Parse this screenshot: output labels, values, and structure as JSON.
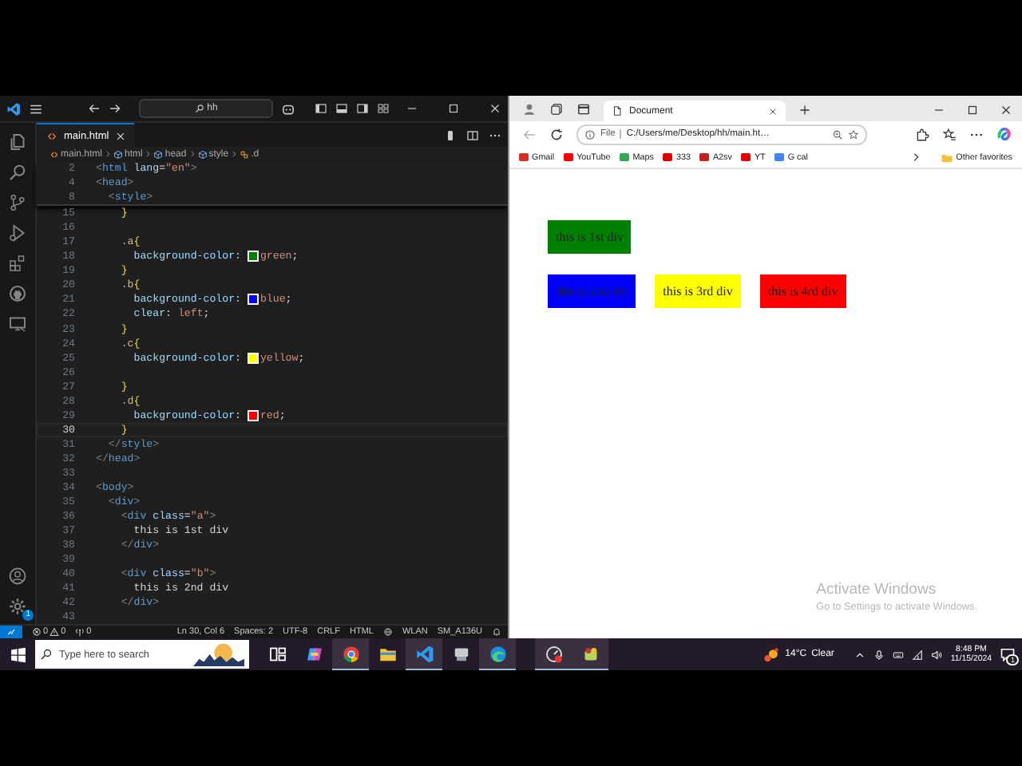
{
  "editor": {
    "search": "hh",
    "tab": {
      "label": "main.html"
    },
    "breadcrumbs": [
      {
        "label": "main.html",
        "kind": "file"
      },
      {
        "label": "html",
        "kind": "element"
      },
      {
        "label": "head",
        "kind": "element"
      },
      {
        "label": "style",
        "kind": "element"
      },
      {
        "label": ".d",
        "kind": "selector"
      }
    ],
    "settings_badge": "1",
    "sticky_lines": [
      {
        "number": "2",
        "current": false,
        "tokens": [
          {
            "text": "<",
            "kind": "punct"
          },
          {
            "text": "html",
            "kind": "tag"
          },
          {
            "text": " lang",
            "kind": "attr"
          },
          {
            "text": "=",
            "kind": "text"
          },
          {
            "text": "\"en\"",
            "kind": "string"
          },
          {
            "text": ">",
            "kind": "punct"
          }
        ]
      },
      {
        "number": "4",
        "current": false,
        "tokens": [
          {
            "text": "<",
            "kind": "punct"
          },
          {
            "text": "head",
            "kind": "tag"
          },
          {
            "text": ">",
            "kind": "punct"
          }
        ]
      },
      {
        "number": "8",
        "current": false,
        "tokens": [
          {
            "text": "  <",
            "kind": "punct"
          },
          {
            "text": "style",
            "kind": "tag"
          },
          {
            "text": ">",
            "kind": "punct"
          }
        ]
      }
    ],
    "lines": [
      {
        "number": "15",
        "current": false,
        "tokens": [
          {
            "text": "    }",
            "kind": "brace"
          }
        ]
      },
      {
        "number": "16",
        "current": false
      },
      {
        "number": "17",
        "current": false,
        "tokens": [
          {
            "text": "    .a",
            "kind": "selector"
          },
          {
            "text": "{",
            "kind": "brace"
          }
        ]
      },
      {
        "number": "18",
        "current": false,
        "tokens": [
          {
            "text": "      background-color: ",
            "kind": "prop"
          },
          {
            "kind": "swatch",
            "color": "#008000"
          },
          {
            "text": "green",
            "kind": "value"
          },
          {
            "text": ";",
            "kind": "text"
          }
        ]
      },
      {
        "number": "19",
        "current": false,
        "tokens": [
          {
            "text": "    }",
            "kind": "brace"
          }
        ]
      },
      {
        "number": "20",
        "current": false,
        "tokens": [
          {
            "text": "    .b",
            "kind": "selector"
          },
          {
            "text": "{",
            "kind": "brace"
          }
        ]
      },
      {
        "number": "21",
        "current": false,
        "tokens": [
          {
            "text": "      background-color: ",
            "kind": "prop"
          },
          {
            "kind": "swatch",
            "color": "#0000ff"
          },
          {
            "text": "blue",
            "kind": "value"
          },
          {
            "text": ";",
            "kind": "text"
          }
        ]
      },
      {
        "number": "22",
        "current": false,
        "tokens": [
          {
            "text": "      clear: ",
            "kind": "prop"
          },
          {
            "text": "left",
            "kind": "value"
          },
          {
            "text": ";",
            "kind": "text"
          }
        ]
      },
      {
        "number": "23",
        "current": false,
        "tokens": [
          {
            "text": "    }",
            "kind": "brace"
          }
        ]
      },
      {
        "number": "24",
        "current": false,
        "tokens": [
          {
            "text": "    .c",
            "kind": "selector"
          },
          {
            "text": "{",
            "kind": "brace"
          }
        ]
      },
      {
        "number": "25",
        "current": false,
        "tokens": [
          {
            "text": "      background-color: ",
            "kind": "prop"
          },
          {
            "kind": "swatch",
            "color": "#ffff00"
          },
          {
            "text": "yellow",
            "kind": "value"
          },
          {
            "text": ";",
            "kind": "text"
          }
        ]
      },
      {
        "number": "26",
        "current": false
      },
      {
        "number": "27",
        "current": false,
        "tokens": [
          {
            "text": "    }",
            "kind": "brace"
          }
        ]
      },
      {
        "number": "28",
        "current": false,
        "tokens": [
          {
            "text": "    .d",
            "kind": "selector"
          },
          {
            "text": "{",
            "kind": "brace"
          }
        ]
      },
      {
        "number": "29",
        "current": false,
        "tokens": [
          {
            "text": "      background-color: ",
            "kind": "prop"
          },
          {
            "kind": "swatch",
            "color": "#ff0000"
          },
          {
            "text": "red",
            "kind": "value"
          },
          {
            "text": ";",
            "kind": "text"
          }
        ]
      },
      {
        "number": "30",
        "current": true,
        "tokens": [
          {
            "text": "    }",
            "kind": "brace"
          }
        ]
      },
      {
        "number": "31",
        "current": false,
        "tokens": [
          {
            "text": "  </",
            "kind": "punct"
          },
          {
            "text": "style",
            "kind": "tag"
          },
          {
            "text": ">",
            "kind": "punct"
          }
        ]
      },
      {
        "number": "32",
        "current": false,
        "tokens": [
          {
            "text": "</",
            "kind": "punct"
          },
          {
            "text": "head",
            "kind": "tag"
          },
          {
            "text": ">",
            "kind": "punct"
          }
        ]
      },
      {
        "number": "33",
        "current": false
      },
      {
        "number": "34",
        "current": false,
        "tokens": [
          {
            "text": "<",
            "kind": "punct"
          },
          {
            "text": "body",
            "kind": "tag"
          },
          {
            "text": ">",
            "kind": "punct"
          }
        ]
      },
      {
        "number": "35",
        "current": false,
        "tokens": [
          {
            "text": "  <",
            "kind": "punct"
          },
          {
            "text": "div",
            "kind": "tag"
          },
          {
            "text": ">",
            "kind": "punct"
          }
        ]
      },
      {
        "number": "36",
        "current": false,
        "tokens": [
          {
            "text": "    <",
            "kind": "punct"
          },
          {
            "text": "div",
            "kind": "tag"
          },
          {
            "text": " class",
            "kind": "attr"
          },
          {
            "text": "=",
            "kind": "text"
          },
          {
            "text": "\"a\"",
            "kind": "string"
          },
          {
            "text": ">",
            "kind": "punct"
          }
        ]
      },
      {
        "number": "37",
        "current": false,
        "tokens": [
          {
            "text": "      this is 1st div",
            "kind": "text"
          }
        ]
      },
      {
        "number": "38",
        "current": false,
        "tokens": [
          {
            "text": "    </",
            "kind": "punct"
          },
          {
            "text": "div",
            "kind": "tag"
          },
          {
            "text": ">",
            "kind": "punct"
          }
        ]
      },
      {
        "number": "39",
        "current": false
      },
      {
        "number": "40",
        "current": false,
        "tokens": [
          {
            "text": "    <",
            "kind": "punct"
          },
          {
            "text": "div",
            "kind": "tag"
          },
          {
            "text": " class",
            "kind": "attr"
          },
          {
            "text": "=",
            "kind": "text"
          },
          {
            "text": "\"b\"",
            "kind": "string"
          },
          {
            "text": ">",
            "kind": "punct"
          }
        ]
      },
      {
        "number": "41",
        "current": false,
        "tokens": [
          {
            "text": "      this is 2nd div",
            "kind": "text"
          }
        ]
      },
      {
        "number": "42",
        "current": false,
        "tokens": [
          {
            "text": "    </",
            "kind": "punct"
          },
          {
            "text": "div",
            "kind": "tag"
          },
          {
            "text": ">",
            "kind": "punct"
          }
        ]
      },
      {
        "number": "43",
        "current": false
      }
    ]
  },
  "status_bar": {
    "errors": "0",
    "warnings": "0",
    "ports": "0",
    "items": [
      "Ln 30, Col 6",
      "Spaces: 2",
      "UTF-8",
      "CRLF",
      "HTML"
    ],
    "network": "WLAN",
    "device": "SM_A136U"
  },
  "browser": {
    "tab": {
      "title": "Document"
    },
    "address": {
      "scheme": "File",
      "url": "C:/Users/me/Desktop/hh/main.ht…"
    },
    "bookmarks": [
      {
        "label": "Gmail",
        "color": "#d93025"
      },
      {
        "label": "YouTube",
        "color": "#ff0000"
      },
      {
        "label": "Maps",
        "color": "#34a853"
      },
      {
        "label": "333",
        "color": "#e00000"
      },
      {
        "label": "A2sv",
        "color": "#c5221f"
      },
      {
        "label": "YT",
        "color": "#e60000"
      },
      {
        "label": "G cal",
        "color": "#4285f4"
      }
    ],
    "other_favorites": "Other favorites",
    "page": {
      "rows": [
        {
          "divs": [
            {
              "text": "this is 1st div",
              "color": "#008000"
            }
          ]
        },
        {
          "divs": [
            {
              "text": "this is 2nd div",
              "color": "#0000ff"
            },
            {
              "text": "this is 3rd div",
              "color": "#ffff00"
            },
            {
              "text": "this is 4rd div",
              "color": "#ff0000"
            }
          ]
        }
      ]
    }
  },
  "activation_notice": {
    "title": "Activate Windows",
    "text": "Go to Settings to activate Windows."
  },
  "taskbar": {
    "search_placeholder": "Type here to search",
    "apps": [
      {
        "kind": "task-view",
        "running": false
      },
      {
        "kind": "assistant",
        "running": false
      },
      {
        "kind": "chrome",
        "running": true
      },
      {
        "kind": "folder",
        "running": false
      },
      {
        "kind": "code",
        "running": true
      },
      {
        "kind": "computer",
        "running": false
      },
      {
        "kind": "edge",
        "running": true
      }
    ],
    "pinned": [
      {
        "kind": "gauge",
        "running": true
      },
      {
        "kind": "game",
        "running": true
      }
    ],
    "weather": {
      "temperature": "14°C",
      "condition": "Clear"
    },
    "time": "8:48 PM",
    "date": "11/15/2024",
    "notification_badge": "1"
  }
}
